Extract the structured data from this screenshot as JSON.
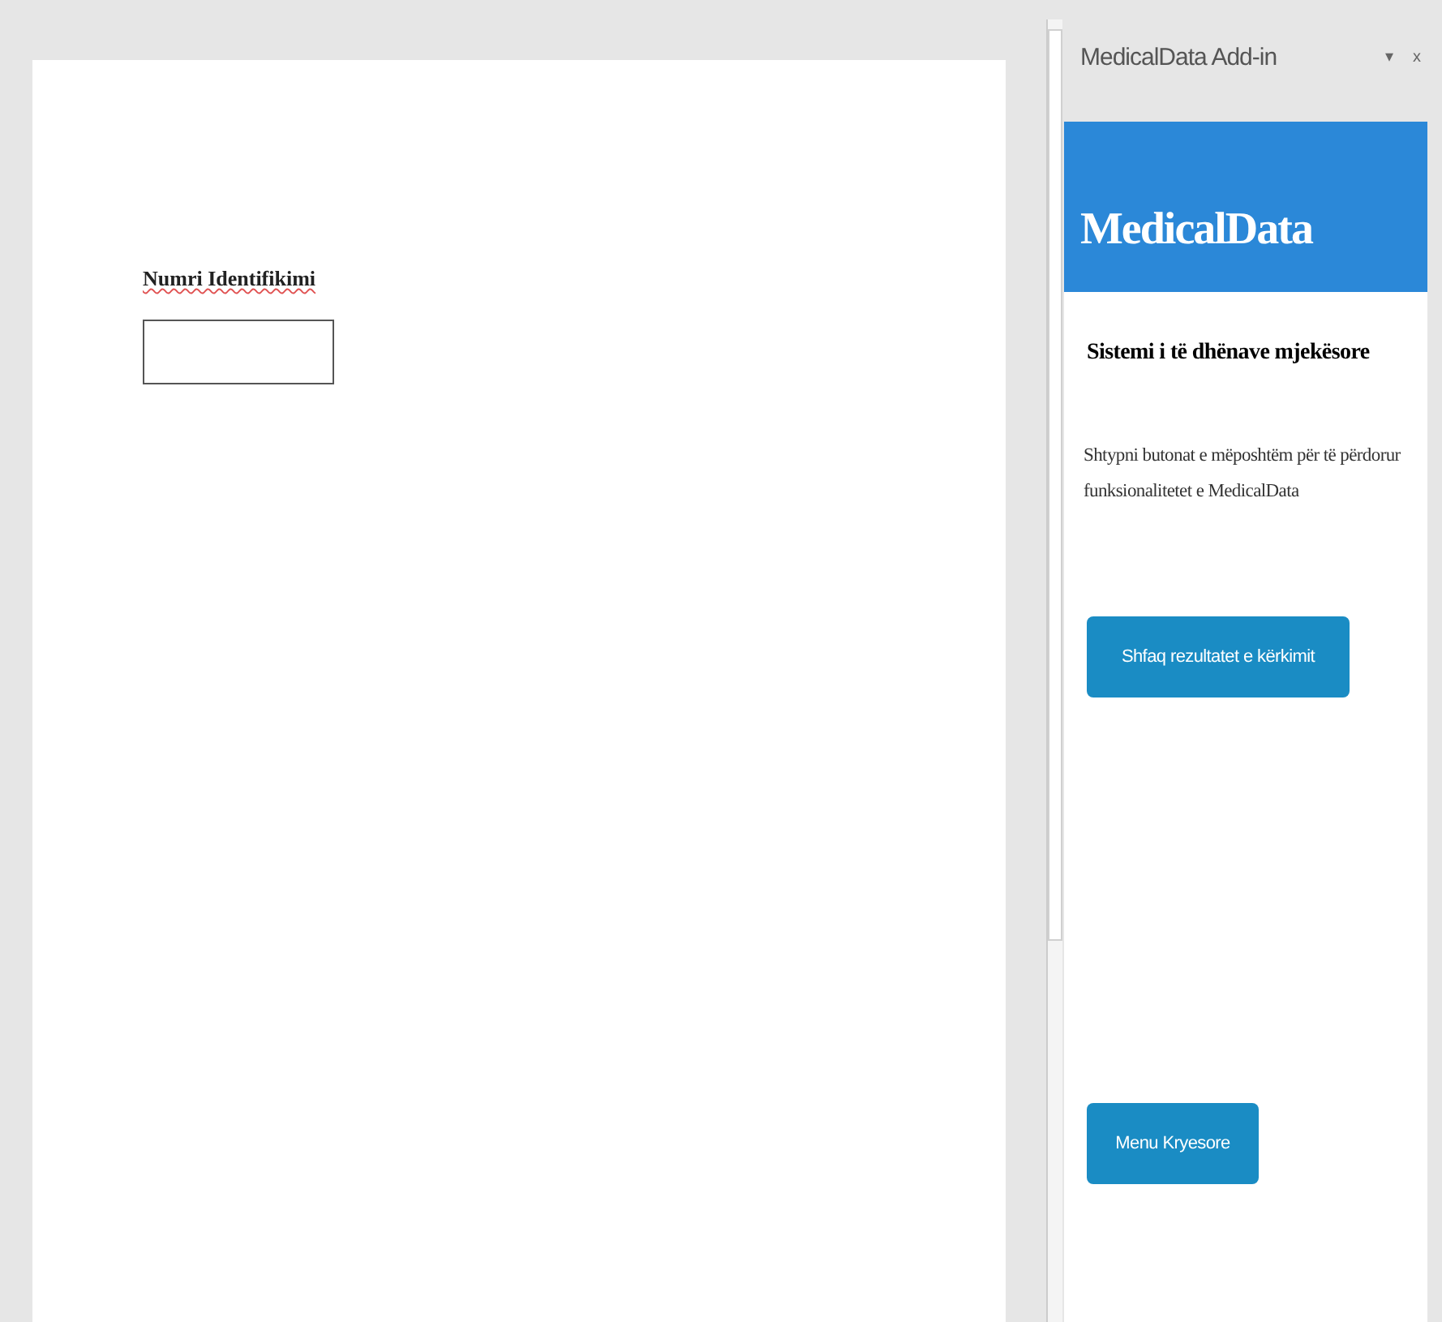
{
  "document": {
    "field_label": "Numri Identifikimi"
  },
  "task_pane": {
    "title": "MedicalData Add-in",
    "menu_glyph": "▾",
    "close_glyph": "x",
    "banner_title": "MedicalData",
    "heading": "Sistemi i të dhënave mjekësore",
    "instructions": "Shtypni butonat e mëposhtëm për të përdorur funksionalitetet e MedicalData",
    "buttons": [
      {
        "label": "Shfaq rezultatet e kërkimit"
      },
      {
        "label": "Menu Kryesore"
      }
    ]
  }
}
